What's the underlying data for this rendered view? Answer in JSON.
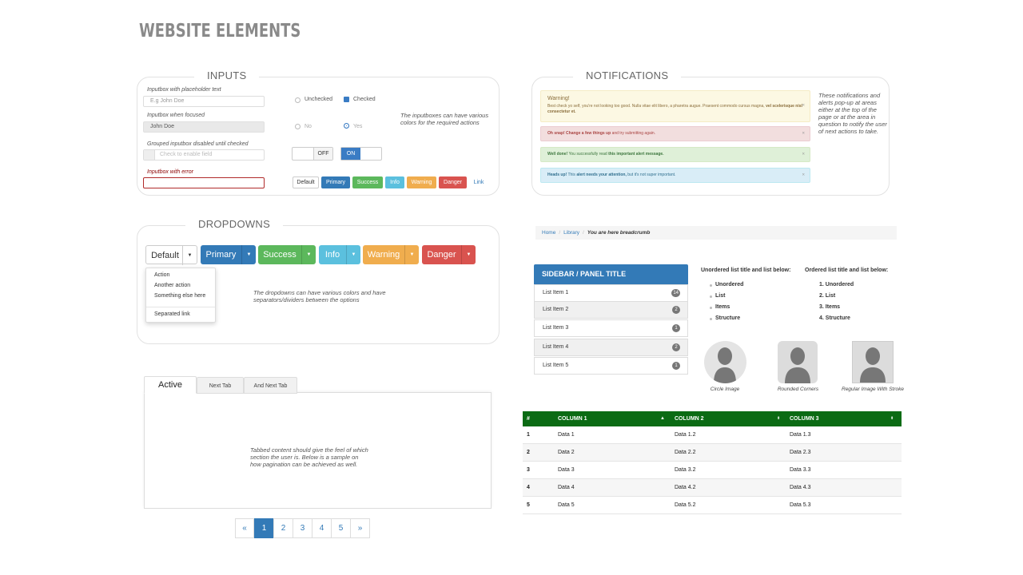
{
  "page_title": "WEBSITE ELEMENTS",
  "inputs": {
    "title": "INPUTS",
    "placeholder_label": "Inputbox with placeholder text",
    "placeholder_value": "E.g John Doe",
    "focused_label": "Inputbox when focused",
    "focused_value": "John Doe",
    "grouped_label": "Grouped inputbox disabled until checked",
    "grouped_value": "Check to enable field",
    "error_label": "Inputbox with error",
    "unchecked_label": "Unchecked",
    "checked_label": "Checked",
    "no_label": "No",
    "yes_label": "Yes",
    "toggle_off": "OFF",
    "toggle_on": "ON",
    "note": "The inputboxes can have various colors for the required actions",
    "buttons": [
      "Default",
      "Primary",
      "Success",
      "Info",
      "Warning",
      "Danger",
      "Link"
    ]
  },
  "dropdowns": {
    "title": "DROPDOWNS",
    "buttons": [
      "Default",
      "Primary",
      "Success",
      "Info",
      "Warning",
      "Danger"
    ],
    "menu_items": [
      "Action",
      "Another action",
      "Something else here",
      "Separated link"
    ],
    "note": "The dropdowns can have various colors and have separators/dividers between the options"
  },
  "notifications": {
    "title": "NOTIFICATIONS",
    "warning_title": "Warning!",
    "warning_text": "Best check yo self, you're not looking too good. Nulla vitae elit libero, a pharetra augue. Praesent commodo cursus magna,",
    "warning_bold": "vel scelerisque nisl consectetur et.",
    "danger_bold": "Oh snap! Change a few things up",
    "danger_text": "and try submitting again.",
    "success_bold": "Well done!",
    "success_text": "You successfully read",
    "success_bold2": "this important alert message.",
    "info_bold": "Heads up!",
    "info_text": "This",
    "info_bold2": "alert needs your attention,",
    "info_text2": "but it's not super important.",
    "close_glyph": "×",
    "note": "These notifications and alerts pop-up at areas either at the top of the page or at the area in question to notify the user of next actions to take."
  },
  "breadcrumb": {
    "items": [
      "Home",
      "Library"
    ],
    "separator": "/",
    "active": "You are here breadcrumb"
  },
  "sidebar": {
    "title": "SIDEBAR / PANEL TITLE",
    "items": [
      {
        "label": "List Item 1",
        "badge": "14"
      },
      {
        "label": "List Item 2",
        "badge": "2"
      },
      {
        "label": "List Item 3",
        "badge": "1"
      },
      {
        "label": "List Item 4",
        "badge": "2"
      },
      {
        "label": "List Item 5",
        "badge": "1"
      }
    ]
  },
  "lists": {
    "unordered_title": "Unordered list title and list below:",
    "unordered_items": [
      "Unordered",
      "List",
      "Items",
      "Structure"
    ],
    "ordered_title": "Ordered list title and list below:",
    "ordered_items": [
      "1. Unordered",
      "2. List",
      "3. Items",
      "4. Structure"
    ]
  },
  "images": {
    "captions": [
      "Circle Image",
      "Rounded Corners",
      "Regular Image With Stroke"
    ]
  },
  "tabs": {
    "labels": [
      "Active",
      "Next Tab",
      "And Next Tab"
    ],
    "content": "Tabbed content should give the feel of which section the user is. Below is a sample on how pagination can be achieved as well."
  },
  "pagination": {
    "prev": "«",
    "pages": [
      "1",
      "2",
      "3",
      "4",
      "5"
    ],
    "next": "»",
    "active_page": "1"
  },
  "table": {
    "headers": [
      "#",
      "COLUMN 1",
      "COLUMN 2",
      "COLUMN 3"
    ],
    "rows": [
      [
        "1",
        "Data 1",
        "Data 1.2",
        "Data 1.3"
      ],
      [
        "2",
        "Data 2",
        "Data 2.2",
        "Data 2.3"
      ],
      [
        "3",
        "Data 3",
        "Data 3.2",
        "Data 3.3"
      ],
      [
        "4",
        "Data 4",
        "Data 4.2",
        "Data 4.3"
      ],
      [
        "5",
        "Data 5",
        "Data 5.2",
        "Data 5.3"
      ]
    ],
    "header_color": "#0b6b14"
  },
  "colors": {
    "primary": "#337ab7",
    "success": "#5cb85c",
    "info": "#5bc0de",
    "warning": "#f0ad4e",
    "danger": "#d9534f"
  }
}
